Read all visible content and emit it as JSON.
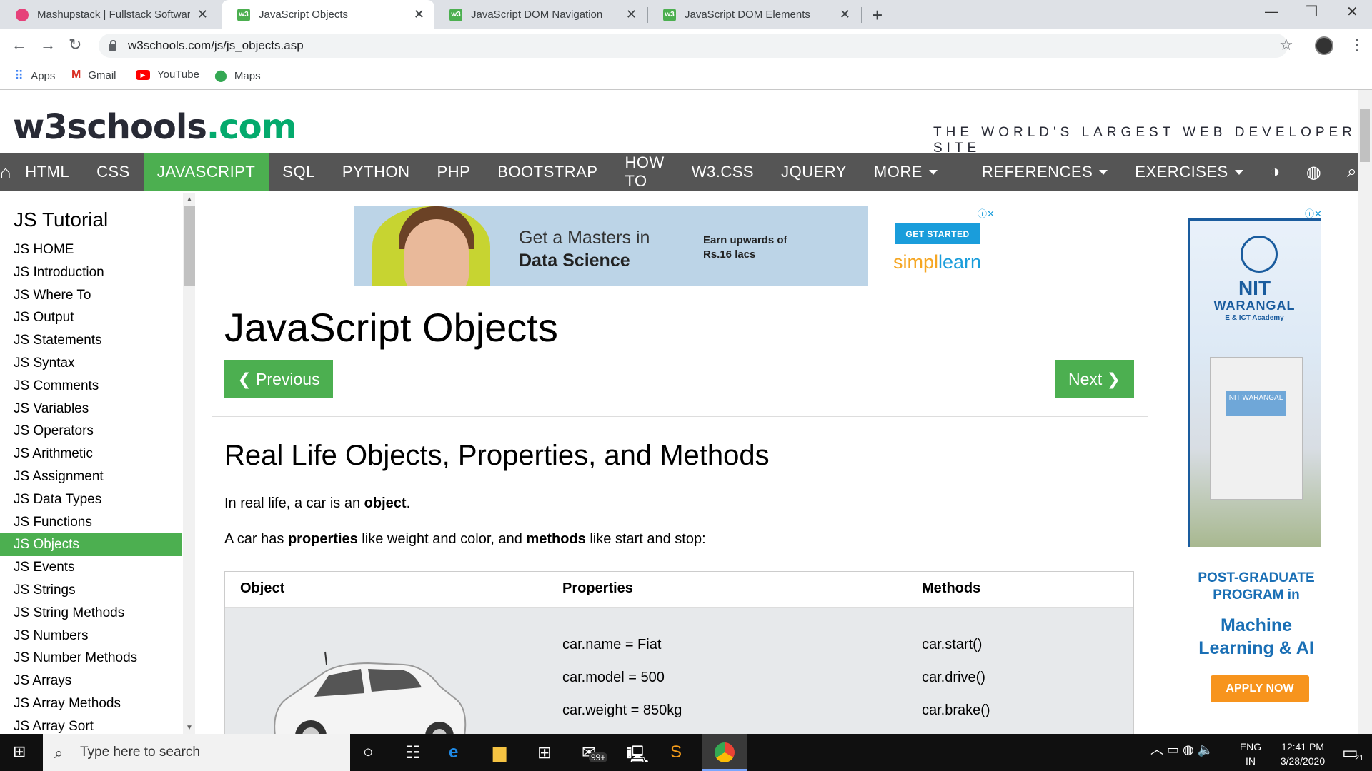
{
  "browser": {
    "tabs": [
      {
        "title": "Mashupstack | Fullstack Software",
        "active": false,
        "favicon_color": "#e6417a"
      },
      {
        "title": "JavaScript Objects",
        "active": true,
        "favicon_color": "#4caf50"
      },
      {
        "title": "JavaScript DOM Navigation",
        "active": false,
        "favicon_color": "#4caf50"
      },
      {
        "title": "JavaScript DOM Elements",
        "active": false,
        "favicon_color": "#4caf50"
      }
    ],
    "favicon_text": "w3",
    "url": "w3schools.com/js/js_objects.asp",
    "bookmarks": [
      {
        "label": "Apps",
        "icon": "apps-grid-icon"
      },
      {
        "label": "Gmail",
        "icon": "gmail-icon"
      },
      {
        "label": "YouTube",
        "icon": "youtube-icon"
      },
      {
        "label": "Maps",
        "icon": "maps-pin-icon"
      }
    ]
  },
  "site": {
    "logo_main": "w3schools",
    "logo_suffix": ".com",
    "tagline": "THE WORLD'S LARGEST WEB DEVELOPER SITE",
    "accent_color": "#4caf50",
    "nav": [
      {
        "label": "HTML"
      },
      {
        "label": "CSS"
      },
      {
        "label": "JAVASCRIPT",
        "active": true
      },
      {
        "label": "SQL"
      },
      {
        "label": "PYTHON"
      },
      {
        "label": "PHP"
      },
      {
        "label": "BOOTSTRAP"
      },
      {
        "label": "HOW TO"
      },
      {
        "label": "W3.CSS"
      },
      {
        "label": "JQUERY"
      }
    ],
    "nav_dropdowns": {
      "more": "MORE",
      "references": "REFERENCES",
      "exercises": "EXERCISES"
    }
  },
  "sidebar": {
    "title": "JS Tutorial",
    "items": [
      "JS HOME",
      "JS Introduction",
      "JS Where To",
      "JS Output",
      "JS Statements",
      "JS Syntax",
      "JS Comments",
      "JS Variables",
      "JS Operators",
      "JS Arithmetic",
      "JS Assignment",
      "JS Data Types",
      "JS Functions",
      "JS Objects",
      "JS Events",
      "JS Strings",
      "JS String Methods",
      "JS Numbers",
      "JS Number Methods",
      "JS Arrays",
      "JS Array Methods",
      "JS Array Sort"
    ],
    "active_item": "JS Objects"
  },
  "ad_top": {
    "line1": "Get a Masters in",
    "line2": "Data Science",
    "line3": "Earn upwards of",
    "line4": "Rs.16 lacs",
    "button": "GET STARTED",
    "brand_a": "simpl",
    "brand_b": "learn"
  },
  "main": {
    "title": "JavaScript Objects",
    "prev_label": "❮ Previous",
    "next_label": "Next ❯",
    "heading": "Real Life Objects, Properties, and Methods",
    "p1_a": "In real life, a car is an ",
    "p1_b": "object",
    "p1_c": ".",
    "p2_a": "A car has ",
    "p2_b": "properties",
    "p2_c": " like weight and color, and ",
    "p2_d": "methods",
    "p2_e": " like start and stop:",
    "table": {
      "headers": [
        "Object",
        "Properties",
        "Methods"
      ],
      "properties": [
        "car.name = Fiat",
        "car.model = 500",
        "car.weight = 850kg"
      ],
      "methods": [
        "car.start()",
        "car.drive()",
        "car.brake()"
      ]
    }
  },
  "ad_right": {
    "nit": "NIT",
    "warangal": "WARANGAL",
    "ict": "E & ICT Academy",
    "sign": "NIT WARANGAL",
    "pg": "POST-GRADUATE PROGRAM in",
    "ml": "Machine Learning & AI",
    "apply": "APPLY NOW"
  },
  "taskbar": {
    "search_placeholder": "Type here to search",
    "lang1": "ENG",
    "lang2": "IN",
    "time": "12:41 PM",
    "date": "3/28/2020",
    "mail_badge": "99+",
    "notif_count": "21"
  }
}
